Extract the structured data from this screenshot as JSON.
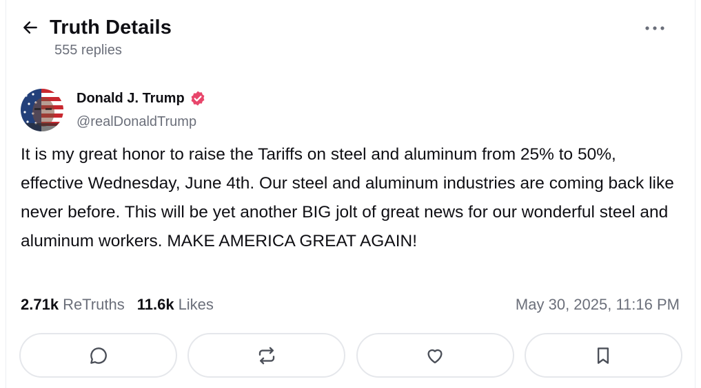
{
  "header": {
    "title": "Truth Details",
    "replies": "555 replies"
  },
  "post": {
    "author_name": "Donald J. Trump",
    "handle": "@realDonaldTrump",
    "text": "It is my great honor to raise the Tariffs on steel and aluminum from 25% to 50%, effective Wednesday, June 4th. Our steel and aluminum industries are coming back like never before. This will be yet another BIG jolt of great news for our wonderful steel and aluminum workers. MAKE AMERICA GREAT AGAIN!",
    "retruths_count": "2.71k",
    "retruths_label": "ReTruths",
    "likes_count": "11.6k",
    "likes_label": "Likes",
    "timestamp": "May 30, 2025, 11:16 PM"
  },
  "icons": {
    "back": "arrow-left-icon",
    "more": "more-horizontal-icon",
    "verified": "verified-badge-icon",
    "reply": "chat-bubble-icon",
    "retruth": "repost-icon",
    "like": "heart-icon",
    "bookmark": "bookmark-icon"
  },
  "colors": {
    "text": "#0f0f14",
    "muted": "#6b6f7a",
    "verified": "#e8466b",
    "border": "#e5e7eb"
  }
}
